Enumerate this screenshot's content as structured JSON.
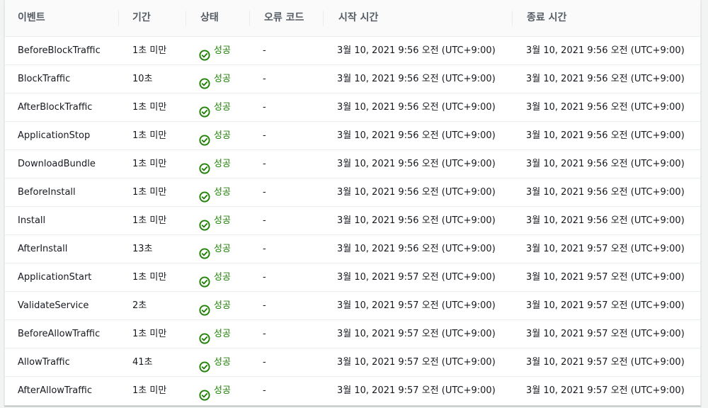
{
  "table": {
    "columns": [
      "이벤트",
      "기간",
      "상태",
      "오류 코드",
      "시작 시간",
      "종료 시간"
    ],
    "status_color": "#1d8102",
    "status_icon": "check-circle-icon",
    "rows": [
      {
        "event": "BeforeBlockTraffic",
        "duration": "1초 미만",
        "status": "성공",
        "error_code": "-",
        "start": "3월 10, 2021 9:56 오전 (UTC+9:00)",
        "end": "3월 10, 2021 9:56 오전 (UTC+9:00)"
      },
      {
        "event": "BlockTraffic",
        "duration": "10초",
        "status": "성공",
        "error_code": "-",
        "start": "3월 10, 2021 9:56 오전 (UTC+9:00)",
        "end": "3월 10, 2021 9:56 오전 (UTC+9:00)"
      },
      {
        "event": "AfterBlockTraffic",
        "duration": "1초 미만",
        "status": "성공",
        "error_code": "-",
        "start": "3월 10, 2021 9:56 오전 (UTC+9:00)",
        "end": "3월 10, 2021 9:56 오전 (UTC+9:00)"
      },
      {
        "event": "ApplicationStop",
        "duration": "1초 미만",
        "status": "성공",
        "error_code": "-",
        "start": "3월 10, 2021 9:56 오전 (UTC+9:00)",
        "end": "3월 10, 2021 9:56 오전 (UTC+9:00)"
      },
      {
        "event": "DownloadBundle",
        "duration": "1초 미만",
        "status": "성공",
        "error_code": "-",
        "start": "3월 10, 2021 9:56 오전 (UTC+9:00)",
        "end": "3월 10, 2021 9:56 오전 (UTC+9:00)"
      },
      {
        "event": "BeforeInstall",
        "duration": "1초 미만",
        "status": "성공",
        "error_code": "-",
        "start": "3월 10, 2021 9:56 오전 (UTC+9:00)",
        "end": "3월 10, 2021 9:56 오전 (UTC+9:00)"
      },
      {
        "event": "Install",
        "duration": "1초 미만",
        "status": "성공",
        "error_code": "-",
        "start": "3월 10, 2021 9:56 오전 (UTC+9:00)",
        "end": "3월 10, 2021 9:56 오전 (UTC+9:00)"
      },
      {
        "event": "AfterInstall",
        "duration": "13초",
        "status": "성공",
        "error_code": "-",
        "start": "3월 10, 2021 9:56 오전 (UTC+9:00)",
        "end": "3월 10, 2021 9:57 오전 (UTC+9:00)"
      },
      {
        "event": "ApplicationStart",
        "duration": "1초 미만",
        "status": "성공",
        "error_code": "-",
        "start": "3월 10, 2021 9:57 오전 (UTC+9:00)",
        "end": "3월 10, 2021 9:57 오전 (UTC+9:00)"
      },
      {
        "event": "ValidateService",
        "duration": "2초",
        "status": "성공",
        "error_code": "-",
        "start": "3월 10, 2021 9:57 오전 (UTC+9:00)",
        "end": "3월 10, 2021 9:57 오전 (UTC+9:00)"
      },
      {
        "event": "BeforeAllowTraffic",
        "duration": "1초 미만",
        "status": "성공",
        "error_code": "-",
        "start": "3월 10, 2021 9:57 오전 (UTC+9:00)",
        "end": "3월 10, 2021 9:57 오전 (UTC+9:00)"
      },
      {
        "event": "AllowTraffic",
        "duration": "41초",
        "status": "성공",
        "error_code": "-",
        "start": "3월 10, 2021 9:57 오전 (UTC+9:00)",
        "end": "3월 10, 2021 9:57 오전 (UTC+9:00)"
      },
      {
        "event": "AfterAllowTraffic",
        "duration": "1초 미만",
        "status": "성공",
        "error_code": "-",
        "start": "3월 10, 2021 9:57 오전 (UTC+9:00)",
        "end": "3월 10, 2021 9:57 오전 (UTC+9:00)"
      }
    ]
  }
}
